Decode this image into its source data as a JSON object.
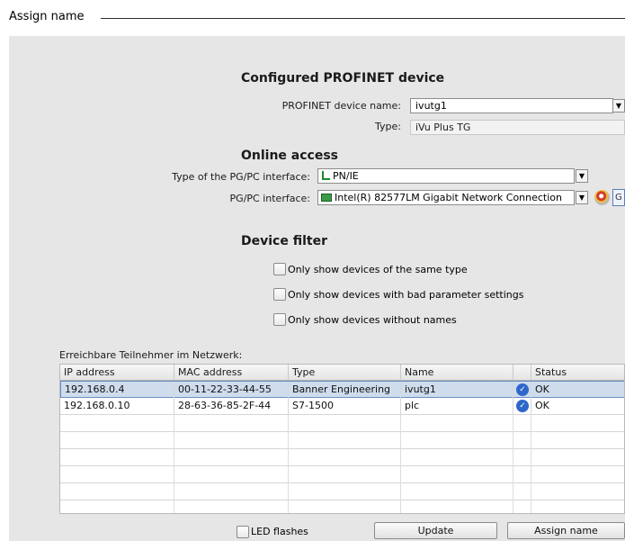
{
  "window": {
    "title": "Assign name"
  },
  "configured": {
    "heading": "Configured PROFINET device",
    "name_label": "PROFINET device name:",
    "name_value": "ivutg1",
    "type_label": "Type:",
    "type_value": "iVu Plus TG"
  },
  "online": {
    "heading": "Online access",
    "interface_type_label": "Type of the PG/PC interface:",
    "interface_type_value": "PN/IE",
    "interface_label": "PG/PC interface:",
    "interface_value": "Intel(R) 82577LM Gigabit Network Connection",
    "side_button_glyph": "G"
  },
  "filter": {
    "heading": "Device filter",
    "options": [
      {
        "label": "Only show devices of the same type",
        "checked": false
      },
      {
        "label": "Only show devices with bad parameter settings",
        "checked": false
      },
      {
        "label": "Only show devices without names",
        "checked": false
      }
    ]
  },
  "network": {
    "caption": "Erreichbare Teilnehmer im Netzwerk:",
    "columns": [
      "IP address",
      "MAC address",
      "Type",
      "Name",
      "Status"
    ],
    "rows": [
      {
        "ip": "192.168.0.4",
        "mac": "00-11-22-33-44-55",
        "type": "Banner Engineering",
        "name": "ivutg1",
        "status": "OK",
        "selected": true
      },
      {
        "ip": "192.168.0.10",
        "mac": "28-63-36-85-2F-44",
        "type": "S7-1500",
        "name": "plc",
        "status": "OK",
        "selected": false
      }
    ]
  },
  "footer": {
    "led_label": "LED flashes",
    "update_label": "Update",
    "assign_label": "Assign name"
  },
  "icons": {
    "dropdown": "▼",
    "status_ok": "✓"
  }
}
